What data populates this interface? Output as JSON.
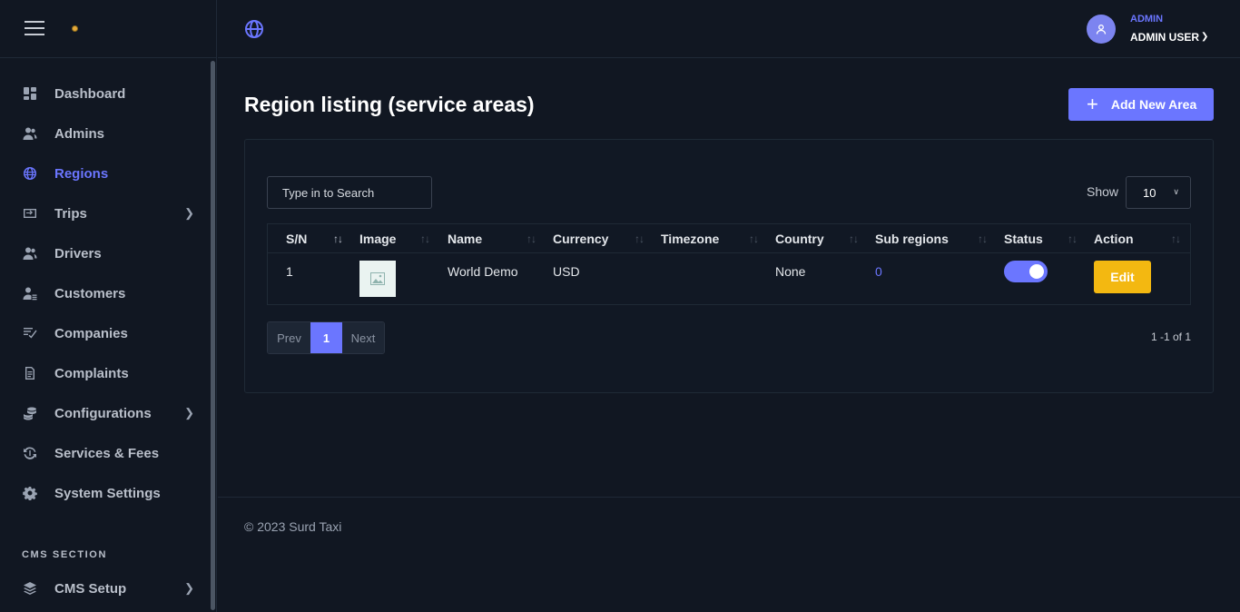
{
  "sidebar": {
    "items": [
      {
        "label": "Dashboard",
        "icon": "dashboard-icon"
      },
      {
        "label": "Admins",
        "icon": "users-icon"
      },
      {
        "label": "Regions",
        "icon": "globe-icon",
        "active": true
      },
      {
        "label": "Trips",
        "icon": "trips-icon",
        "has_submenu": true
      },
      {
        "label": "Drivers",
        "icon": "users-icon"
      },
      {
        "label": "Customers",
        "icon": "customers-icon"
      },
      {
        "label": "Companies",
        "icon": "companies-icon"
      },
      {
        "label": "Complaints",
        "icon": "document-icon"
      },
      {
        "label": "Configurations",
        "icon": "coins-icon",
        "has_submenu": true
      },
      {
        "label": "Services & Fees",
        "icon": "fees-icon"
      },
      {
        "label": "System Settings",
        "icon": "gear-icon"
      }
    ],
    "cms_section_label": "CMS SECTION",
    "cms_items": [
      {
        "label": "CMS Setup",
        "icon": "layers-icon",
        "has_submenu": true
      }
    ]
  },
  "header": {
    "user_role": "ADMIN",
    "user_name": "ADMIN USER"
  },
  "main": {
    "title": "Region listing (service areas)",
    "add_button_label": "Add New Area",
    "search_placeholder": "Type in to Search",
    "show_label": "Show",
    "show_value": "10",
    "columns": [
      "S/N",
      "Image",
      "Name",
      "Currency",
      "Timezone",
      "Country",
      "Sub regions",
      "Status",
      "Action"
    ],
    "rows": [
      {
        "sn": "1",
        "name": "World Demo",
        "currency": "USD",
        "timezone": "",
        "country": "None",
        "sub_regions": "0",
        "status_on": true,
        "action_label": "Edit"
      }
    ],
    "pagination": {
      "prev": "Prev",
      "current": "1",
      "next": "Next",
      "range": "1 -1 of 1"
    }
  },
  "footer": {
    "text": "© 2023 Surd Taxi"
  },
  "colors": {
    "accent": "#6b76ff",
    "edit": "#f3b811",
    "background": "#111722"
  }
}
